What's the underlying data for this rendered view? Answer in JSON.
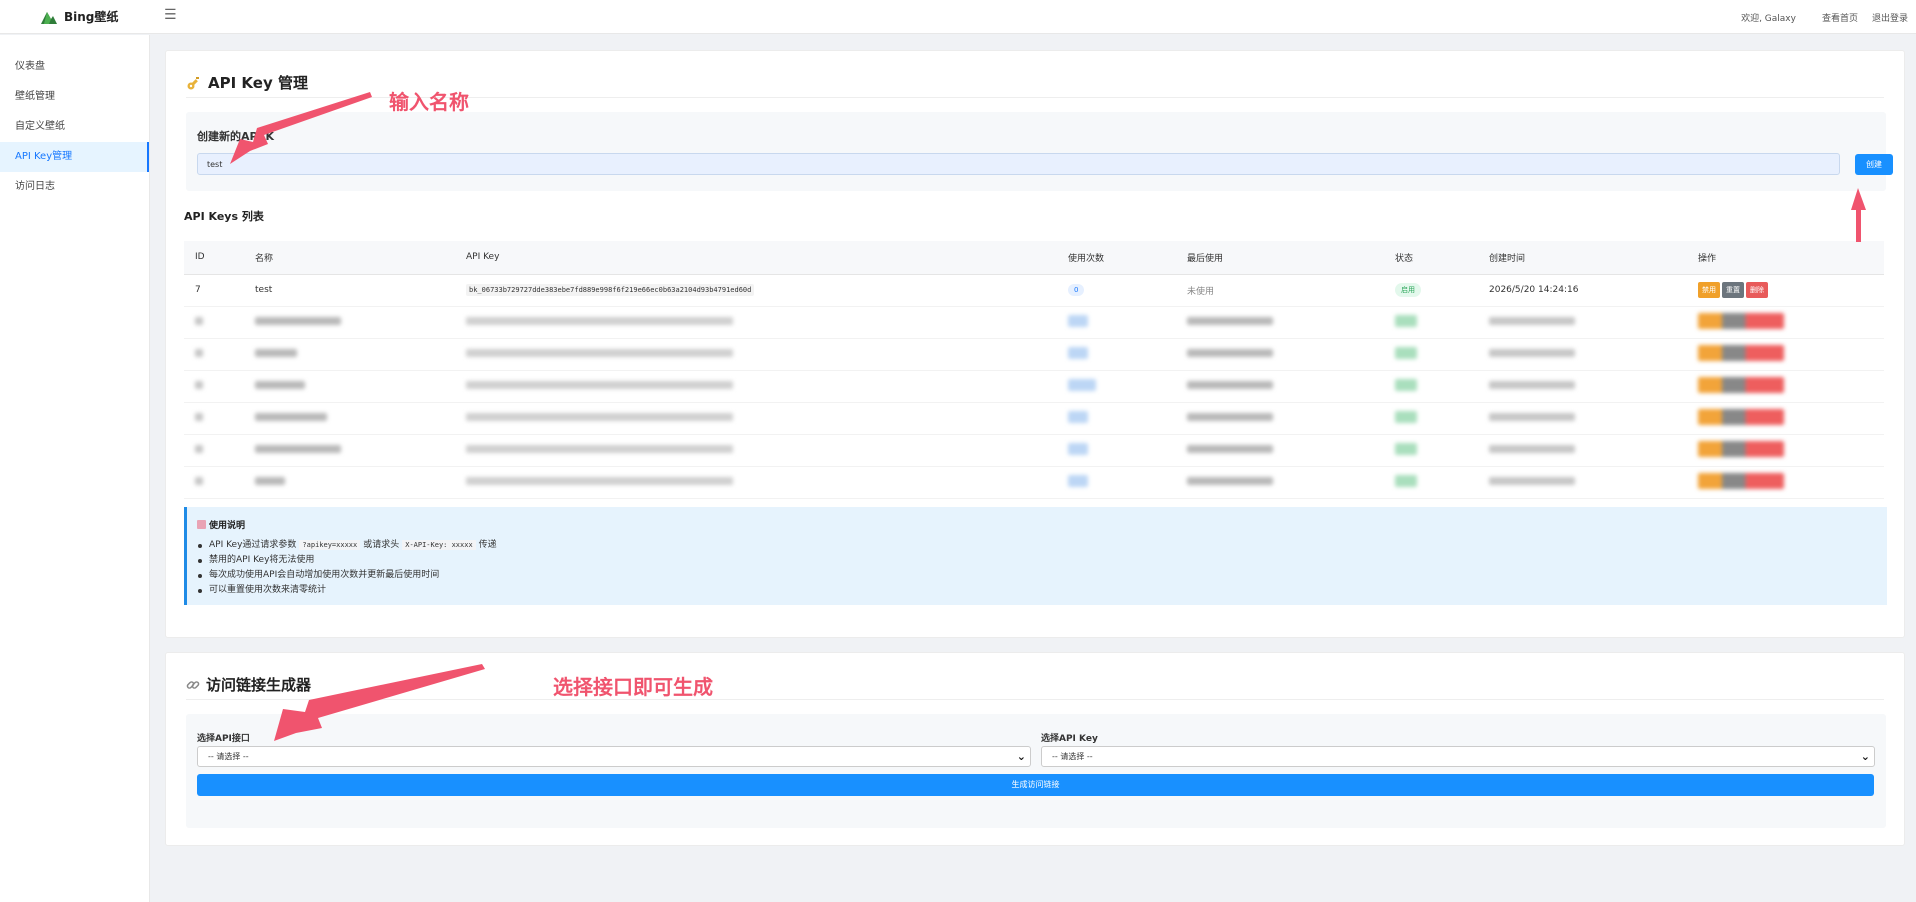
{
  "header": {
    "app_name": "Bing壁纸",
    "menu_icon": "hamburger-icon",
    "welcome": "欢迎, Galaxy",
    "view_home": "查看首页",
    "logout": "退出登录"
  },
  "sidebar": {
    "items": [
      {
        "label": "仪表盘"
      },
      {
        "label": "壁纸管理"
      },
      {
        "label": "自定义壁纸"
      },
      {
        "label": "API Key管理"
      },
      {
        "label": "访问日志"
      }
    ],
    "active_index": 3
  },
  "api_key_card": {
    "title": "API Key 管理",
    "icon": "key-icon",
    "create_label": "创建新的API K",
    "name_value": "test",
    "create_button": "创建",
    "list_title": "API Keys 列表",
    "columns": [
      "ID",
      "名称",
      "API Key",
      "使用次数",
      "最后使用",
      "状态",
      "创建时间",
      "操作"
    ],
    "rows": [
      {
        "id": "7",
        "name": "test",
        "key": "bk_06733b729727dde383ebe7fd889e998f6f219e66ec0b63a2104d93b4791ed60d",
        "count": "0",
        "last_used": "未使用",
        "status": "启用",
        "created": "2026/5/20 14:24:16",
        "actions": [
          "禁用",
          "重置",
          "删除"
        ]
      }
    ]
  },
  "notice": {
    "icon": "book-icon",
    "title": "使用说明",
    "item1_prefix": "API Key通过请求参数",
    "item1_code1": "?apikey=xxxxx",
    "item1_mid": "或请求头",
    "item1_code2": "X-API-Key: xxxxx",
    "item1_suffix": "传递",
    "item2": "禁用的API Key将无法使用",
    "item3": "每次成功使用API会自动增加使用次数并更新最后使用时间",
    "item4": "可以重置使用次数来清零统计"
  },
  "link_card": {
    "title": "访问链接生成器",
    "icon": "link-icon",
    "api_label": "选择API接口",
    "api_value": "-- 请选择 --",
    "key_label": "选择API Key",
    "key_value": "-- 请选择 --",
    "generate_button": "生成访问链接"
  },
  "annotations": {
    "input_name": "输入名称",
    "select_api": "选择接口即可生成",
    "color": "#f0546e"
  },
  "colors": {
    "primary": "#1890ff",
    "warning": "#f0a02a",
    "secondary": "#6c757d",
    "danger": "#e85a5a",
    "success": "#2ea65b"
  }
}
